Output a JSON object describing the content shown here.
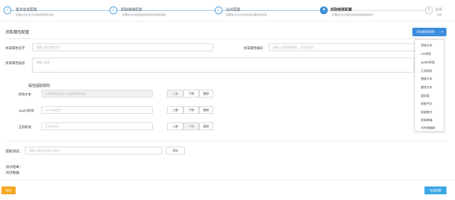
{
  "stepper": {
    "steps": [
      {
        "title": "基本信息配置",
        "desc": "配置商业的名字和描述等基本信息",
        "state": "done"
      },
      {
        "title": "抓取链接配置",
        "desc": "配置商业的超链接抓取规则和抓取链接",
        "state": "done"
      },
      {
        "title": "站点配置",
        "desc": "配置商业的访问规则和创建请求参数",
        "state": "done"
      },
      {
        "title": "抓取结果配置",
        "desc": "配置商业的抓取结果规则和取值规则",
        "state": "active",
        "number": "4"
      },
      {
        "title": "完成",
        "desc": "完成",
        "state": "pending",
        "number": "5"
      }
    ]
  },
  "section": {
    "title": "抓取属性配置",
    "add_rule_label": "添加抓取规则",
    "caret": "▾"
  },
  "dropdown": {
    "items": [
      "原始文本",
      "css抓取",
      "xpath抓取",
      "正则抓取",
      "替换文本",
      "删除文本",
      "固定值",
      "抓取中文",
      "抓取数字",
      "抓取邮箱",
      "字符串截取"
    ]
  },
  "form": {
    "name_label": "抓取属性名字",
    "name_placeholder": "请输入抓取属性名字",
    "code_label": "抓取属性编码",
    "code_placeholder": "请输入抓取属性编码，必须是字母",
    "desc_label": "抓取属性描述",
    "desc_placeholder": "请输入描述"
  },
  "rules": {
    "title": "属性提取规则",
    "items": [
      {
        "label": "原始文本",
        "placeholder": "对原始文本没有可以配置的数据项",
        "disabled": true,
        "up_disabled": true,
        "down_disabled": false
      },
      {
        "label": "xpath抓取",
        "placeholder": "xpath表达式",
        "disabled": false,
        "up_disabled": false,
        "down_disabled": false
      },
      {
        "label": "正则抓取",
        "placeholder": "正则表达式",
        "disabled": false,
        "up_disabled": false,
        "down_disabled": true
      }
    ],
    "up_label": "上移",
    "down_label": "下移",
    "delete_label": "删除"
  },
  "test": {
    "label": "提取测试：",
    "placeholder": "请输入测试目标的url地址",
    "button_label": "测试"
  },
  "result": {
    "line1": "测试结果：",
    "line2": "测试数据"
  },
  "footer": {
    "cancel_label": "取消",
    "finish_label": "完成配置"
  }
}
